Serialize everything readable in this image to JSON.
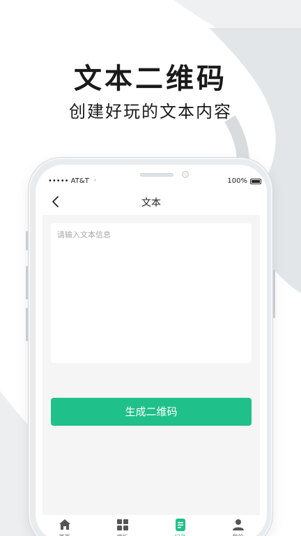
{
  "promo": {
    "headline": "文本二维码",
    "subhead": "创建好玩的文本内容"
  },
  "status_bar": {
    "carrier": "••••• AT&T",
    "signal_symbol": "ᐧ",
    "battery": "100%"
  },
  "nav": {
    "title": "文本"
  },
  "editor": {
    "placeholder": "请输入文本信息",
    "value": ""
  },
  "generate_button": "生成二维码",
  "tabbar": {
    "items": [
      {
        "label": "首页",
        "icon": "home-icon",
        "active": false
      },
      {
        "label": "模板",
        "icon": "grid-icon",
        "active": false
      },
      {
        "label": "记录",
        "icon": "record-icon",
        "active": true
      },
      {
        "label": "我的",
        "icon": "user-icon",
        "active": false
      }
    ]
  },
  "colors": {
    "accent": "#20c08a",
    "tab_inactive": "#777777",
    "content_bg": "#f5f5f5"
  }
}
